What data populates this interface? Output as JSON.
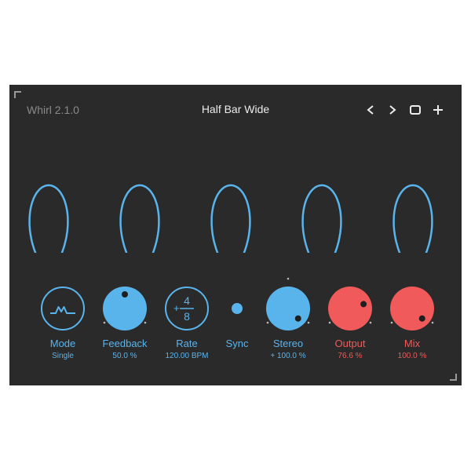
{
  "header": {
    "app_title": "Whirl 2.1.0",
    "preset_name": "Half Bar Wide"
  },
  "toolbar": {
    "prev_icon": "chevron-left-icon",
    "next_icon": "chevron-right-icon",
    "save_icon": "square-icon",
    "add_icon": "plus-icon"
  },
  "controls": {
    "mode": {
      "label": "Mode",
      "value": "Single",
      "icon": "waveform-m-icon"
    },
    "feedback": {
      "label": "Feedback",
      "value": "50.0 %",
      "level": 0.5
    },
    "rate": {
      "label": "Rate",
      "value": "120.00 BPM",
      "numerator": "4",
      "denominator": "8",
      "prefix": "+"
    },
    "sync": {
      "label": "Sync"
    },
    "stereo": {
      "label": "Stereo",
      "value": "+ 100.0 %",
      "level": 1.0
    },
    "output": {
      "label": "Output",
      "value": "76.6 %",
      "level": 0.766
    },
    "mix": {
      "label": "Mix",
      "value": "100.0 %",
      "level": 1.0
    }
  },
  "colors": {
    "background": "#2a2a2a",
    "accent_blue": "#5ab4ec",
    "accent_red": "#f05a5a",
    "text_light": "#ececec",
    "text_dim": "#8a8a8a"
  }
}
